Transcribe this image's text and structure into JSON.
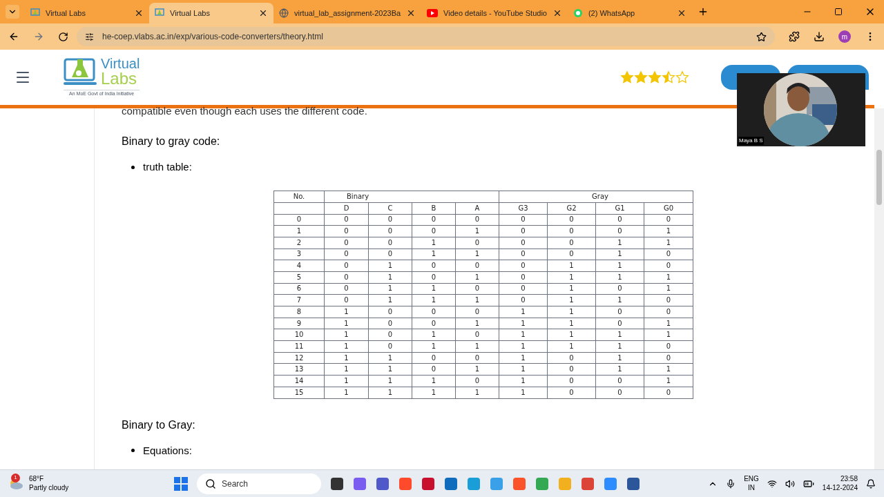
{
  "browser": {
    "tabs": [
      {
        "title": "Virtual Labs",
        "kind": "vlabs",
        "selected": false
      },
      {
        "title": "Virtual Labs",
        "kind": "vlabs",
        "selected": true
      },
      {
        "title": "virtual_lab_assignment-2023Ba",
        "kind": "globe",
        "selected": false
      },
      {
        "title": "Video details - YouTube Studio",
        "kind": "youtube",
        "selected": false
      },
      {
        "title": "(2) WhatsApp",
        "kind": "whatsapp",
        "selected": false
      }
    ],
    "url": "he-coep.vlabs.ac.in/exp/various-code-converters/theory.html",
    "profile_initial": "m"
  },
  "header": {
    "logo_top": "Virtual",
    "logo_bottom": "Labs",
    "logo_tagline": "An MoE Govt of India Initiative",
    "rating": {
      "stars": 3.5
    }
  },
  "content": {
    "intro": "compatible even though each uses the different code.",
    "heading_1": "Binary to gray code:",
    "bullet_1": "truth table:",
    "table": {
      "groups": [
        "No.",
        "Binary",
        "Gray"
      ],
      "columns": [
        "",
        "D",
        "C",
        "B",
        "A",
        "G3",
        "G2",
        "G1",
        "G0"
      ],
      "rows": [
        [
          "0",
          "0",
          "0",
          "0",
          "0",
          "0",
          "0",
          "0",
          "0"
        ],
        [
          "1",
          "0",
          "0",
          "0",
          "1",
          "0",
          "0",
          "0",
          "1"
        ],
        [
          "2",
          "0",
          "0",
          "1",
          "0",
          "0",
          "0",
          "1",
          "1"
        ],
        [
          "3",
          "0",
          "0",
          "1",
          "1",
          "0",
          "0",
          "1",
          "0"
        ],
        [
          "4",
          "0",
          "1",
          "0",
          "0",
          "0",
          "1",
          "1",
          "0"
        ],
        [
          "5",
          "0",
          "1",
          "0",
          "1",
          "0",
          "1",
          "1",
          "1"
        ],
        [
          "6",
          "0",
          "1",
          "1",
          "0",
          "0",
          "1",
          "0",
          "1"
        ],
        [
          "7",
          "0",
          "1",
          "1",
          "1",
          "0",
          "1",
          "1",
          "0"
        ],
        [
          "8",
          "1",
          "0",
          "0",
          "0",
          "1",
          "1",
          "0",
          "0"
        ],
        [
          "9",
          "1",
          "0",
          "0",
          "1",
          "1",
          "1",
          "0",
          "1"
        ],
        [
          "10",
          "1",
          "0",
          "1",
          "0",
          "1",
          "1",
          "1",
          "1"
        ],
        [
          "11",
          "1",
          "0",
          "1",
          "1",
          "1",
          "1",
          "1",
          "0"
        ],
        [
          "12",
          "1",
          "1",
          "0",
          "0",
          "1",
          "0",
          "1",
          "0"
        ],
        [
          "13",
          "1",
          "1",
          "0",
          "1",
          "1",
          "0",
          "1",
          "1"
        ],
        [
          "14",
          "1",
          "1",
          "1",
          "0",
          "1",
          "0",
          "0",
          "1"
        ],
        [
          "15",
          "1",
          "1",
          "1",
          "1",
          "1",
          "0",
          "0",
          "0"
        ]
      ]
    },
    "heading_2": "Binary to Gray:",
    "bullet_2": "Equations:"
  },
  "video_overlay": {
    "name": "Maya B S",
    "kind": "picture"
  },
  "taskbar": {
    "weather": {
      "badge": "1",
      "temperature": "68°F",
      "condition": "Partly cloudy"
    },
    "search": {
      "placeholder": "Search"
    },
    "language": [
      "ENG",
      "IN"
    ],
    "time": "23:58",
    "date": "14-12-2024"
  }
}
